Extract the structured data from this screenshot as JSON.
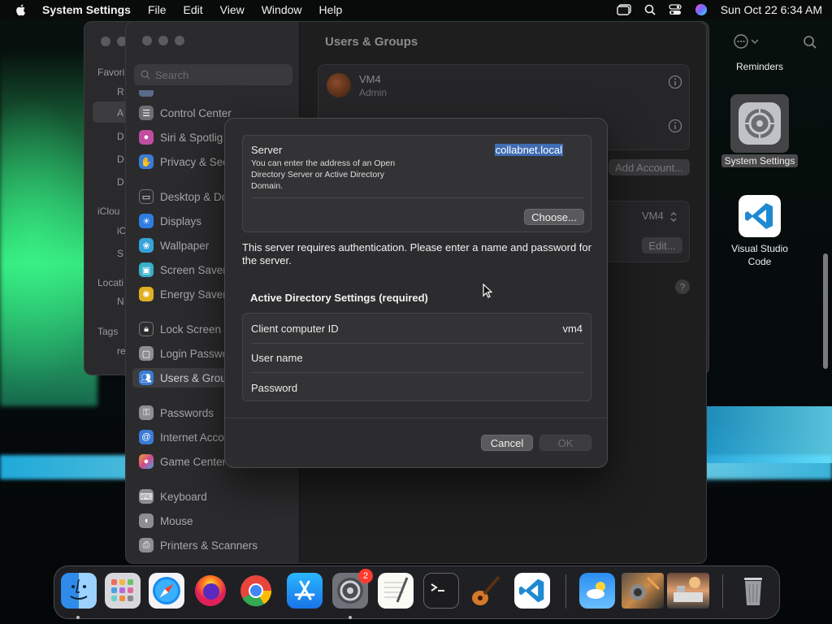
{
  "menubar": {
    "app_name": "System Settings",
    "items": [
      "File",
      "Edit",
      "View",
      "Window",
      "Help"
    ],
    "clock": "Sun Oct 22  6:34 AM"
  },
  "back_window": {
    "labels": [
      "Favori",
      "R",
      "A",
      "D",
      "D",
      "D",
      "iClou",
      "iC",
      "S",
      "Locati",
      "N",
      "Tags",
      "re"
    ]
  },
  "desktop": {
    "reminders_label": "Reminders",
    "system_settings_label": "System Settings",
    "vscode_label_line1": "Visual Studio",
    "vscode_label_line2": "Code"
  },
  "settings": {
    "search_placeholder": "Search",
    "sidebar_items": [
      {
        "label": "Control Center",
        "color": "#6e6e72"
      },
      {
        "label": "Siri & Spotlig",
        "color": "#c04ea0"
      },
      {
        "label": "Privacy & Sec",
        "color": "#3a7bd5"
      },
      {
        "label": "Desktop & Do",
        "color": "#2d2d2f"
      },
      {
        "label": "Displays",
        "color": "#2f7de1"
      },
      {
        "label": "Wallpaper",
        "color": "#36a3d9"
      },
      {
        "label": "Screen Saver",
        "color": "#38b0c8"
      },
      {
        "label": "Energy Saver",
        "color": "#e0b020"
      },
      {
        "label": "Lock Screen",
        "color": "#2d2d2f"
      },
      {
        "label": "Login Passwo",
        "color": "#8e8e92"
      },
      {
        "label": "Users & Grou",
        "color": "#3a7bd5"
      },
      {
        "label": "Passwords",
        "color": "#8e8e92"
      },
      {
        "label": "Internet Acco",
        "color": "#3a7bd5"
      },
      {
        "label": "Game Center",
        "color": "#d04a8a"
      },
      {
        "label": "Keyboard",
        "color": "#8e8e92"
      },
      {
        "label": "Mouse",
        "color": "#8e8e92"
      },
      {
        "label": "Printers & Scanners",
        "color": "#8e8e92"
      }
    ],
    "content_title": "Users & Groups",
    "user_name": "VM4",
    "user_role": "Admin",
    "add_account": "Add Account...",
    "auto_login_value": "VM4",
    "edit_button": "Edit..."
  },
  "dialog": {
    "server_label": "Server",
    "server_desc": "You can enter the address of an Open Directory Server or Active Directory Domain.",
    "server_value": "collabnet.local",
    "choose_button": "Choose...",
    "auth_message": "This server requires authentication. Please enter a name and password for the server.",
    "ad_section_title": "Active Directory Settings (required)",
    "client_id_label": "Client computer ID",
    "client_id_value": "vm4",
    "username_label": "User name",
    "password_label": "Password",
    "cancel_button": "Cancel",
    "ok_button": "OK"
  },
  "dock": {
    "settings_badge": "2"
  }
}
